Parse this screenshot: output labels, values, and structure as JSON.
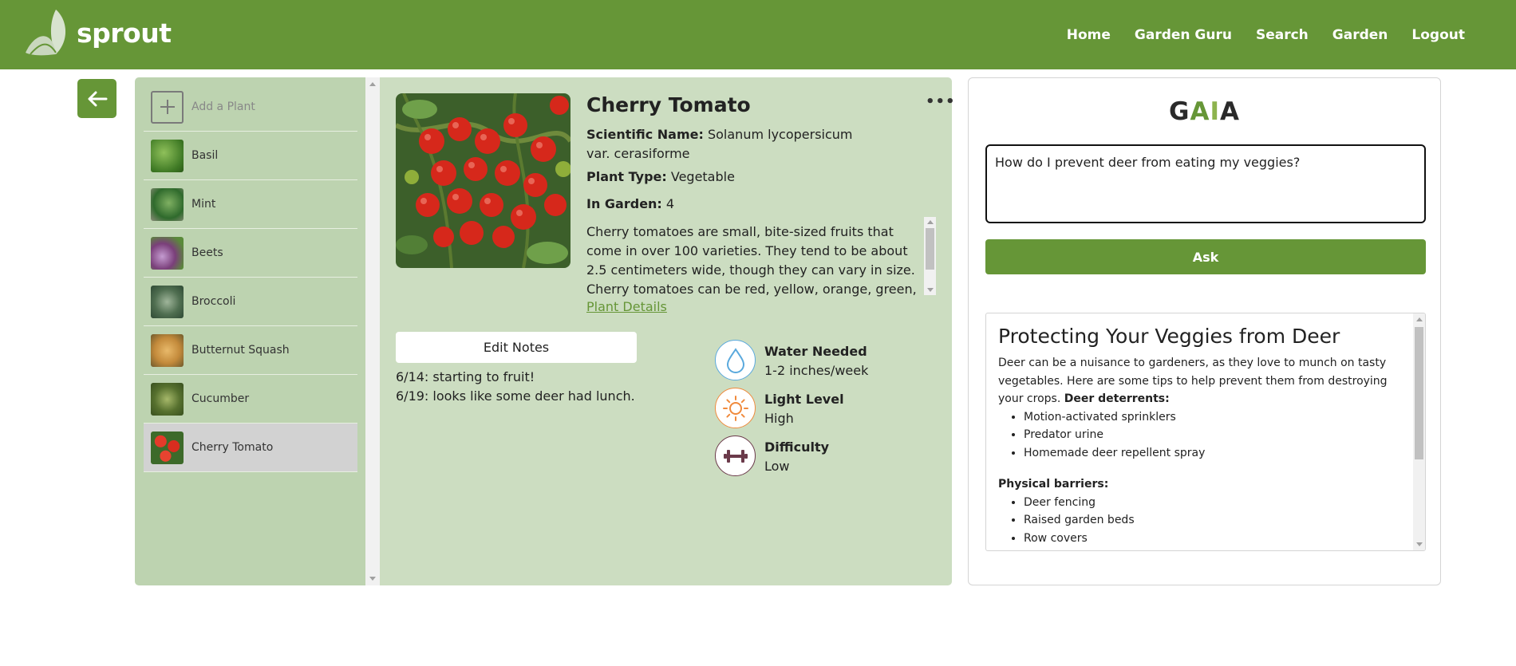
{
  "app": {
    "name": "sprout",
    "logo_icon": "leaf-icon",
    "brand_color": "#669637"
  },
  "nav": {
    "items": [
      {
        "label": "Home"
      },
      {
        "label": "Garden Guru"
      },
      {
        "label": "Search"
      },
      {
        "label": "Garden"
      },
      {
        "label": "Logout"
      }
    ]
  },
  "back_button": {
    "icon": "arrow-left-icon"
  },
  "plant_list": {
    "add_label": "Add a Plant",
    "items": [
      {
        "label": "Basil"
      },
      {
        "label": "Mint"
      },
      {
        "label": "Beets"
      },
      {
        "label": "Broccoli"
      },
      {
        "label": "Butternut Squash"
      },
      {
        "label": "Cucumber"
      },
      {
        "label": "Cherry Tomato",
        "selected": true
      }
    ]
  },
  "plant": {
    "name": "Cherry Tomato",
    "scientific_label": "Scientific Name:",
    "scientific_name": "Solanum lycopersicum var. cerasiforme",
    "type_label": "Plant Type:",
    "type": "Vegetable",
    "garden_label": "In Garden:",
    "garden_count": "4",
    "description": "Cherry tomatoes are small, bite-sized fruits that come in over 100 varieties. They tend to be about 2.5 centimeters wide, though they can vary in size. Cherry tomatoes can be red, yellow, orange, green, or dark",
    "details_link": "Plant Details",
    "menu_icon": "more-dots-icon"
  },
  "notes": {
    "button_label": "Edit Notes",
    "lines": [
      "6/14: starting to fruit!",
      "6/19: looks like some deer had lunch."
    ]
  },
  "stats": {
    "water": {
      "title": "Water Needed",
      "value": "1-2 inches/week",
      "icon": "water-drop-icon",
      "color": "#5aa9dd"
    },
    "light": {
      "title": "Light Level",
      "value": "High",
      "icon": "sun-icon",
      "color": "#f08a3c"
    },
    "difficulty": {
      "title": "Difficulty",
      "value": "Low",
      "icon": "dumbbell-icon",
      "color": "#6b3a4a"
    }
  },
  "gaia": {
    "logo_letters": [
      "G",
      "A",
      "I",
      "A"
    ],
    "question": "How do I prevent deer from eating my veggies?",
    "ask_label": "Ask",
    "answer": {
      "title": "Protecting Your Veggies from Deer",
      "intro": "Deer can be a nuisance to gardeners, as they love to munch on tasty vegetables. Here are some tips to help prevent them from destroying your crops.",
      "deterrents_heading": "Deer deterrents:",
      "deterrents": [
        "Motion-activated sprinklers",
        "Predator urine",
        "Homemade deer repellent spray"
      ],
      "barriers_heading": "Physical barriers:",
      "barriers": [
        "Deer fencing",
        "Raised garden beds",
        "Row covers"
      ]
    }
  }
}
